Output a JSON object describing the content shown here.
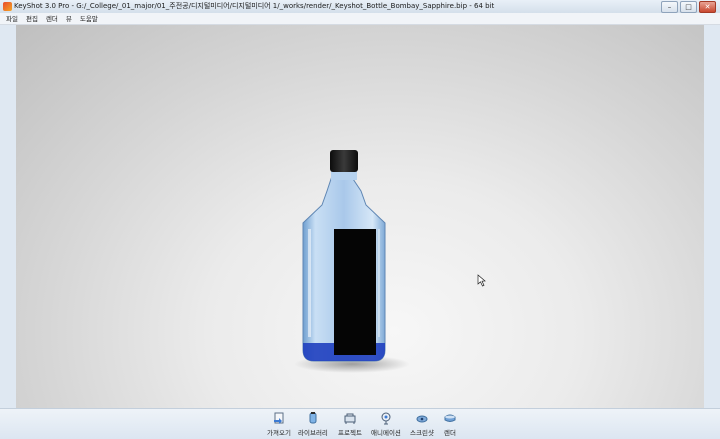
{
  "window": {
    "title": "KeyShot 3.0 Pro  - G:/_College/_01_major/01_주전공/디지털미디어/디지털미디어 1/_works/render/_Keyshot_Bottle_Bombay_Sapphire.bip - 64 bit",
    "controls": {
      "minimize": "–",
      "maximize": "□",
      "close": "✕"
    }
  },
  "menu": [
    {
      "label": "파일"
    },
    {
      "label": "편집"
    },
    {
      "label": "렌더"
    },
    {
      "label": "뷰"
    },
    {
      "label": "도움말"
    }
  ],
  "toolbar": [
    {
      "label": "가져오기",
      "icon": "import-icon"
    },
    {
      "label": "라이브러리",
      "icon": "library-icon"
    },
    {
      "label": "프로젝트",
      "icon": "project-icon"
    },
    {
      "label": "애니메이션",
      "icon": "animation-icon"
    },
    {
      "label": "스크린샷",
      "icon": "screenshot-icon"
    },
    {
      "label": "렌더",
      "icon": "render-icon"
    }
  ],
  "colors": {
    "bottle_glass": "#9fc3e8",
    "bottle_cap": "#1c1c1c",
    "bottle_label": "#050505",
    "bottle_base": "#1f3fbf"
  }
}
